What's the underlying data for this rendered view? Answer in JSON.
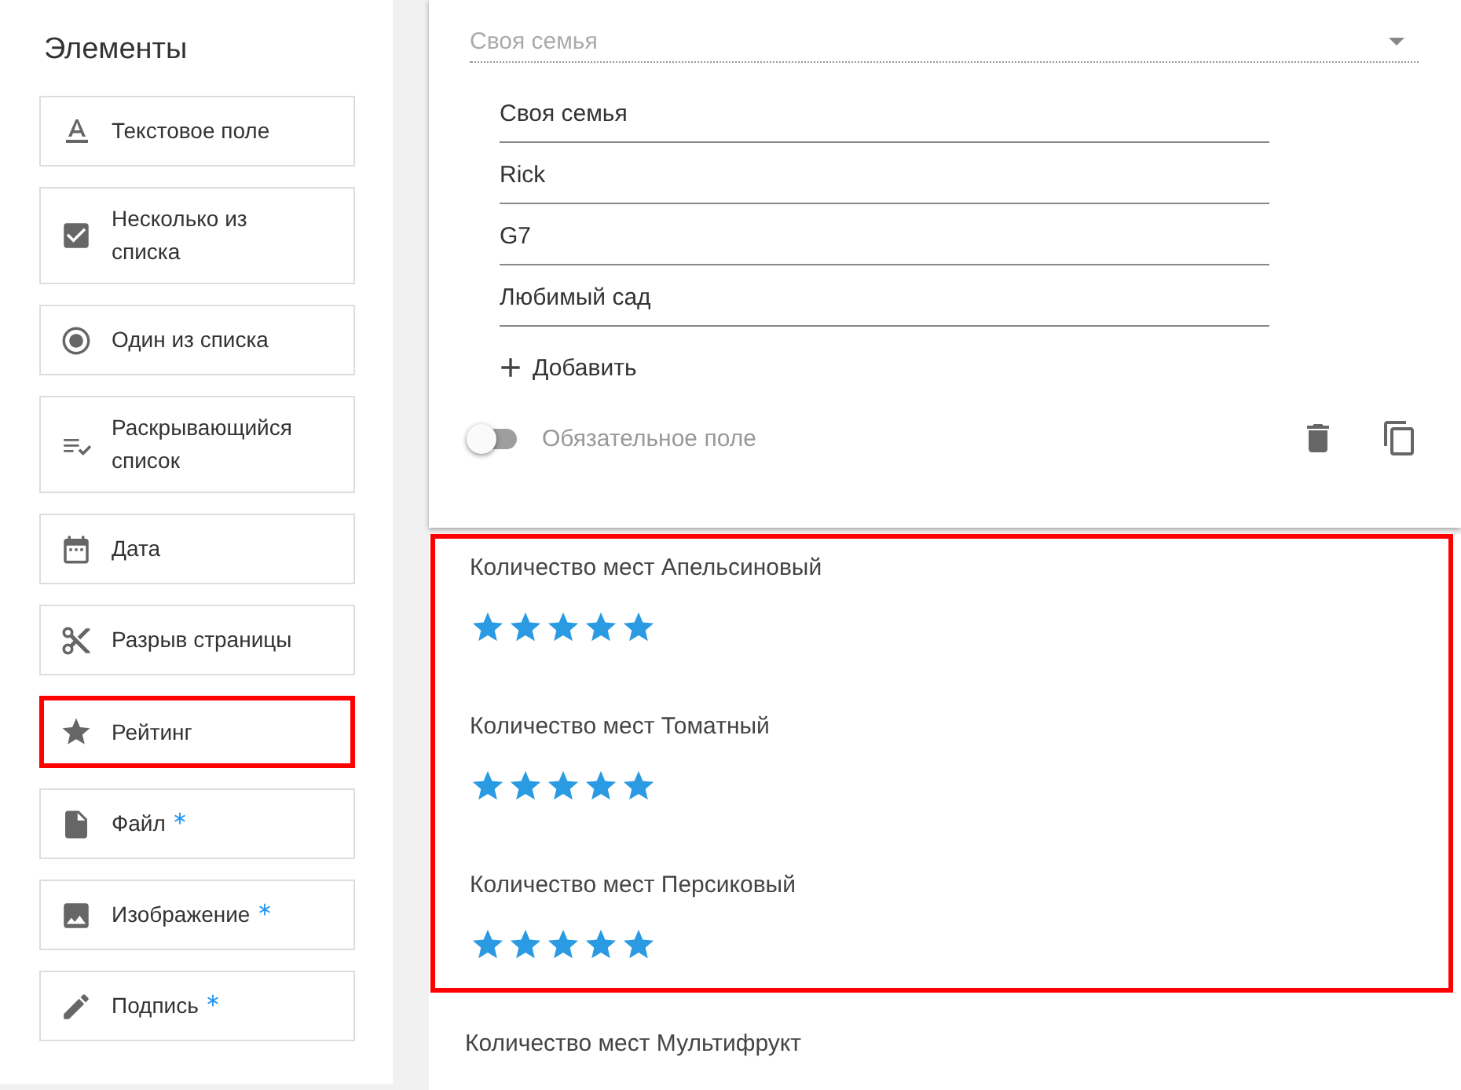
{
  "sidebar": {
    "title": "Элементы",
    "items": [
      {
        "label": "Текстовое поле",
        "kind": "text",
        "required": false,
        "highlighted": false
      },
      {
        "label": "Несколько из списка",
        "kind": "checkbox",
        "required": false,
        "highlighted": false
      },
      {
        "label": "Один из списка",
        "kind": "radio",
        "required": false,
        "highlighted": false
      },
      {
        "label": "Раскрывающийся список",
        "kind": "dropdown",
        "required": false,
        "highlighted": false
      },
      {
        "label": "Дата",
        "kind": "date",
        "required": false,
        "highlighted": false
      },
      {
        "label": "Разрыв страницы",
        "kind": "pagebreak",
        "required": false,
        "highlighted": false
      },
      {
        "label": "Рейтинг",
        "kind": "rating",
        "required": false,
        "highlighted": true
      },
      {
        "label": "Файл",
        "kind": "file",
        "required": true,
        "highlighted": false
      },
      {
        "label": "Изображение",
        "kind": "image",
        "required": true,
        "highlighted": false
      },
      {
        "label": "Подпись",
        "kind": "signature",
        "required": true,
        "highlighted": false
      }
    ]
  },
  "editor": {
    "dropdown": {
      "placeholder": "Своя семья"
    },
    "options": [
      "Своя семья",
      "Rick",
      "G7",
      "Любимый сад"
    ],
    "add_button": "Добавить",
    "required_toggle": {
      "label": "Обязательное поле",
      "on": false
    }
  },
  "rating_groups": [
    {
      "highlighted": true,
      "questions": [
        {
          "label": "Количество мест Апельсиновый",
          "stars": 5
        },
        {
          "label": "Количество мест Томатный",
          "stars": 5
        },
        {
          "label": "Количество мест Персиковый",
          "stars": 5
        }
      ]
    },
    {
      "highlighted": false,
      "questions": [
        {
          "label": "Количество мест Мультифрукт"
        }
      ]
    }
  ]
}
